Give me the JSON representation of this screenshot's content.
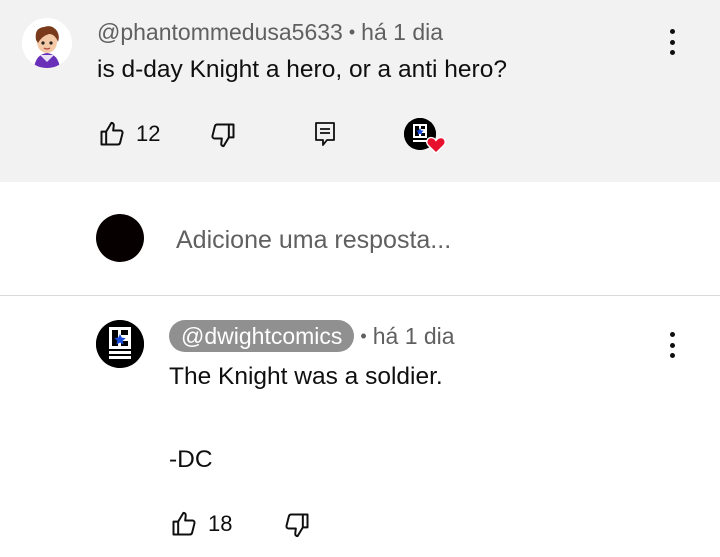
{
  "top_comment": {
    "author": "@phantommedusa5633",
    "separator": "•",
    "time": "há 1 dia",
    "text": "is d-day Knight a hero, or a anti hero?",
    "like_count": "12",
    "creator_heart_icon": "heart-icon"
  },
  "reply_box": {
    "placeholder": "Adicione uma resposta..."
  },
  "reply_comment": {
    "author": "@dwightcomics",
    "separator": "•",
    "time": "há 1 dia",
    "text_line1": "The Knight was a soldier.",
    "text_line2": "-DC",
    "like_count": "18",
    "avatar_logo": "DC",
    "avatar_caption": "DWIGHT COMICS"
  },
  "colors": {
    "highlight_bg": "#f2f2f2",
    "secondary_text": "#606060",
    "chip_bg": "#909090",
    "heart": "#e8112d"
  }
}
